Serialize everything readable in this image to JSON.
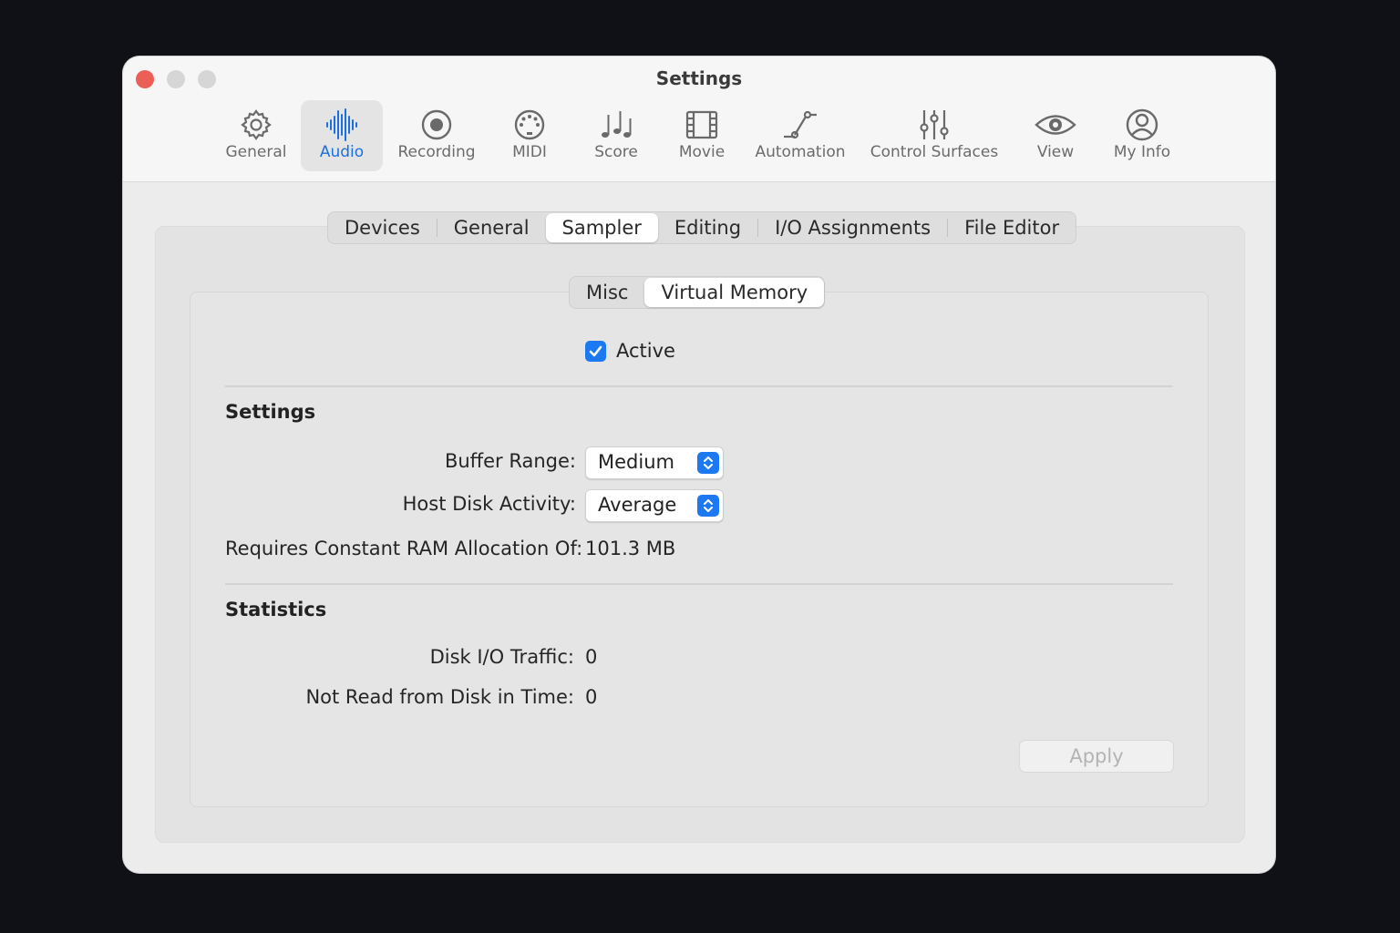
{
  "window": {
    "title": "Settings"
  },
  "toolbar": {
    "items": [
      {
        "label": "General",
        "icon": "gear-icon"
      },
      {
        "label": "Audio",
        "icon": "waveform-icon",
        "selected": true
      },
      {
        "label": "Recording",
        "icon": "record-icon"
      },
      {
        "label": "MIDI",
        "icon": "midi-connector-icon"
      },
      {
        "label": "Score",
        "icon": "music-notes-icon"
      },
      {
        "label": "Movie",
        "icon": "film-icon"
      },
      {
        "label": "Automation",
        "icon": "automation-curve-icon"
      },
      {
        "label": "Control Surfaces",
        "icon": "sliders-icon"
      },
      {
        "label": "View",
        "icon": "eye-icon"
      },
      {
        "label": "My Info",
        "icon": "person-circle-icon"
      }
    ]
  },
  "audio_tabs": {
    "items": [
      "Devices",
      "General",
      "Sampler",
      "Editing",
      "I/O Assignments",
      "File Editor"
    ],
    "selected": "Sampler"
  },
  "sampler_tabs": {
    "items": [
      "Misc",
      "Virtual Memory"
    ],
    "selected": "Virtual Memory"
  },
  "virtual_memory": {
    "active_label": "Active",
    "active_checked": true,
    "settings_title": "Settings",
    "buffer_range_label": "Buffer Range:",
    "buffer_range_value": "Medium",
    "host_disk_label": "Host Disk Activity:",
    "host_disk_value": "Average",
    "ram_label": "Requires Constant RAM Allocation Of:",
    "ram_value": "101.3 MB",
    "statistics_title": "Statistics",
    "disk_io_label": "Disk I/O Traffic:",
    "disk_io_value": "0",
    "not_read_label": "Not Read from Disk in Time:",
    "not_read_value": "0",
    "apply_label": "Apply"
  },
  "colors": {
    "accent": "#1d79f2",
    "selected_toolbar_text": "#1b6fe0",
    "close_button": "#ec5f57",
    "background": "#0f1116"
  }
}
